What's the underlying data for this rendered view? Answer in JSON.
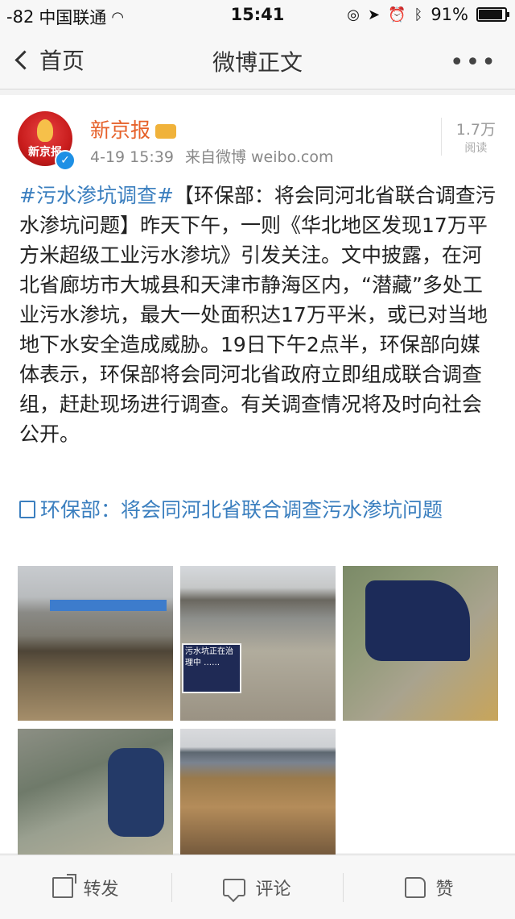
{
  "status_bar": {
    "signal": "-82",
    "carrier": "中国联通",
    "time": "15:41",
    "battery": "91%"
  },
  "nav": {
    "back_label": "首页",
    "title": "微博正文",
    "more": "•••"
  },
  "post": {
    "username": "新京报",
    "avatar_text": "新京报",
    "time": "4-19 15:39",
    "source": "来自微博 weibo.com",
    "read_count": "1.7万",
    "read_label": "阅读",
    "hashtag": "#污水渗坑调查#",
    "text": "【环保部：将会同河北省联合调查污水渗坑问题】昨天下午，一则《华北地区发现17万平方米超级工业污水渗坑》引发关注。文中披露，在河北省廊坊市大城县和天津市静海区内，“潜藏”多处工业污水渗坑，最大一处面积达17万平米，或已对当地地下水安全造成威胁。19日下午2点半，环保部向媒体表示，环保部将会同河北省政府立即组成联合调查组，赶赴现场进行调查。有关调查情况将及时向社会公开。",
    "link_text": "环保部：将会同河北省联合调查污水渗坑问题",
    "sign_text": "污水坑正在治理中 ……"
  },
  "actions": {
    "repost": "转发",
    "comment": "评论",
    "like": "赞"
  }
}
